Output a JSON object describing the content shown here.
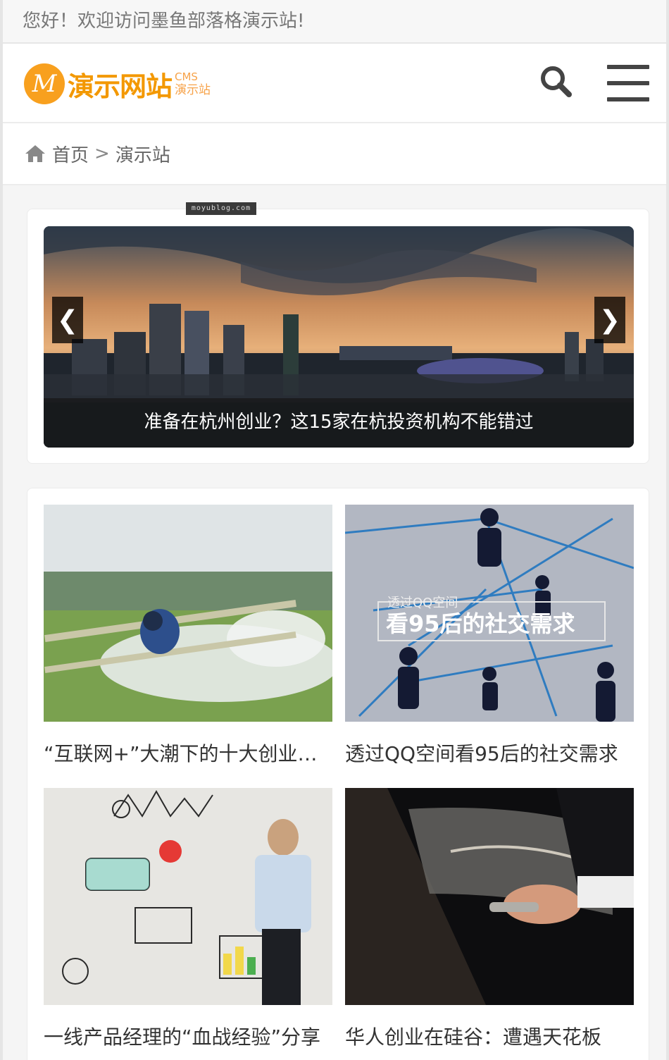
{
  "welcome": {
    "text": "您好！欢迎访问墨鱼部落格演示站!"
  },
  "header": {
    "logo": {
      "letter": "M",
      "name": "演示网站",
      "sub_top": "CMS",
      "sub_bottom": "演示站"
    },
    "search_icon": "search-icon",
    "menu_icon": "hamburger-menu-icon"
  },
  "breadcrumb": {
    "home": "首页",
    "separator": ">",
    "current": "演示站"
  },
  "watermark": "moyublog.com",
  "slider": {
    "caption": "准备在杭州创业？这15家在杭投资机构不能错过",
    "prev": "❮",
    "next": "❯"
  },
  "articles": [
    {
      "title": "“互联网+”大潮下的十大创业机会"
    },
    {
      "title": "透过QQ空间看95后的社交需求",
      "image_text_small": "透过QQ空间",
      "image_text_big": "看95后的社交需求"
    },
    {
      "title": "一线产品经理的“血战经验”分享"
    },
    {
      "title": "华人创业在硅谷：遭遇天花板"
    }
  ],
  "colors": {
    "brand": "#f39800",
    "text": "#333333"
  }
}
